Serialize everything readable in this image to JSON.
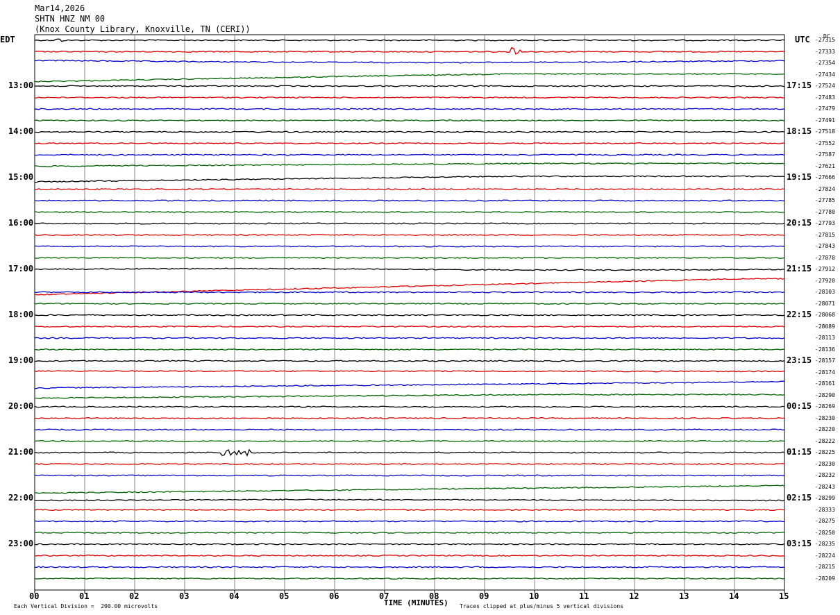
{
  "header": {
    "date": "Mar14,2026",
    "station": "SHTN HNZ NM 00",
    "location": "(Knox County Library, Knoxville, TN (CERI))"
  },
  "left_axis_label": "EDT",
  "right_axis_label": "UTC",
  "dc_label": "DC",
  "left_hour_labels": [
    "13:00",
    "14:00",
    "15:00",
    "16:00",
    "17:00",
    "18:00",
    "19:00",
    "20:00",
    "21:00",
    "22:00",
    "23:00"
  ],
  "right_hour_labels": [
    "17:15",
    "18:15",
    "19:15",
    "20:15",
    "21:15",
    "22:15",
    "23:15",
    "00:15",
    "01:15",
    "02:15",
    "03:15"
  ],
  "right_offsets": [
    "-27315",
    "-27333",
    "-27354",
    "-27434",
    "-27524",
    "-27483",
    "-27479",
    "-27491",
    "-27518",
    "-27552",
    "-27587",
    "-27621",
    "-27666",
    "-27824",
    "-27785",
    "-27780",
    "-27793",
    "-27815",
    "-27843",
    "-27878",
    "-27912",
    "-27920",
    "-28103",
    "-28071",
    "-28068",
    "-28089",
    "-28113",
    "-28136",
    "-28157",
    "-28174",
    "-28161",
    "-28290",
    "-28269",
    "-28230",
    "-28220",
    "-28222",
    "-28225",
    "-28230",
    "-28232",
    "-28243",
    "-28299",
    "-28333",
    "-28275",
    "-28250",
    "-28235",
    "-28224",
    "-28215",
    "-28209"
  ],
  "x_ticks": [
    "00",
    "01",
    "02",
    "03",
    "04",
    "05",
    "06",
    "07",
    "08",
    "09",
    "10",
    "11",
    "12",
    "13",
    "14",
    "15"
  ],
  "x_axis_title": "TIME (MINUTES)",
  "footer_left": "Each Vertical Division =  200.00 microvolts",
  "footer_right": "Traces clipped at plus/minus 5 vertical divisions",
  "trace_colors": [
    "#000000",
    "#dd0000",
    "#0000cc",
    "#006600"
  ],
  "grid_color": "#888888"
}
